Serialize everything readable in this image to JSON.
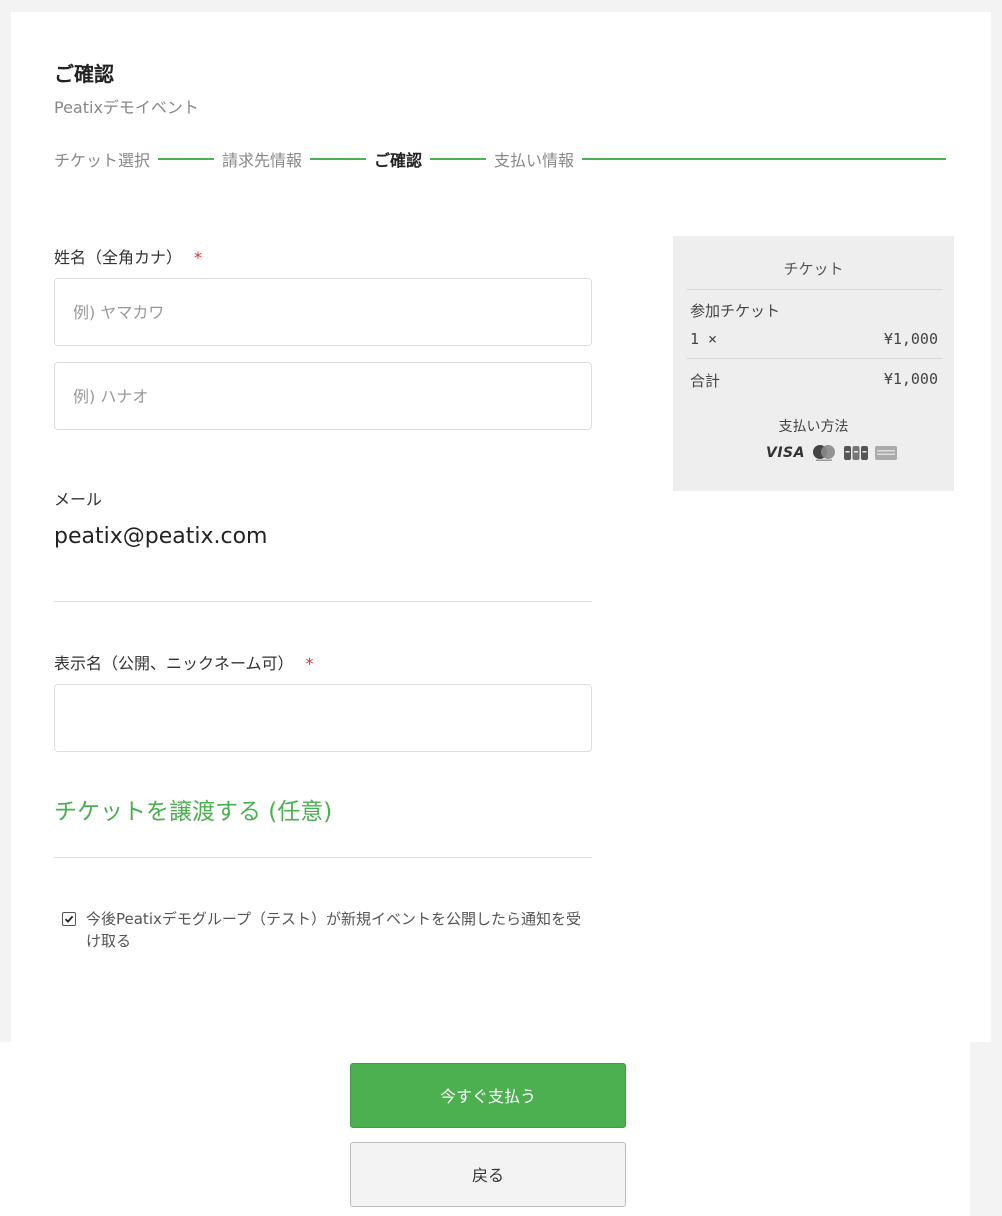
{
  "header": {
    "title": "ご確認",
    "event_name": "Peatixデモイベント"
  },
  "steps": [
    "チケット選択",
    "請求先情報",
    "ご確認",
    "支払い情報"
  ],
  "form": {
    "name_label": "姓名（全角カナ）",
    "required_mark": "*",
    "last_name_placeholder": "例) ヤマカワ",
    "first_name_placeholder": "例) ハナオ",
    "email_label": "メール",
    "email_value": "peatix@peatix.com",
    "display_name_label": "表示名（公開、ニックネーム可）",
    "display_name_value": "",
    "transfer_link": "チケットを譲渡する (任意)",
    "optin_text": "今後Peatixデモグループ（テスト）が新規イベントを公開したら通知を受け取る",
    "optin_checked": true
  },
  "summary": {
    "heading": "チケット",
    "item_name": "参加チケット",
    "quantity": "1 ×",
    "item_price": "¥1,000",
    "total_label": "合計",
    "total_value": "¥1,000",
    "payment_label": "支払い方法",
    "payment_icons": [
      "visa-icon",
      "mastercard-icon",
      "jcb-icon",
      "amex-icon"
    ],
    "visa_text": "VISA"
  },
  "buttons": {
    "pay": "今すぐ支払う",
    "back": "戻る"
  },
  "colors": {
    "accent": "#4caf50",
    "required": "#dd3333",
    "summary_bg": "#eeeeee"
  }
}
